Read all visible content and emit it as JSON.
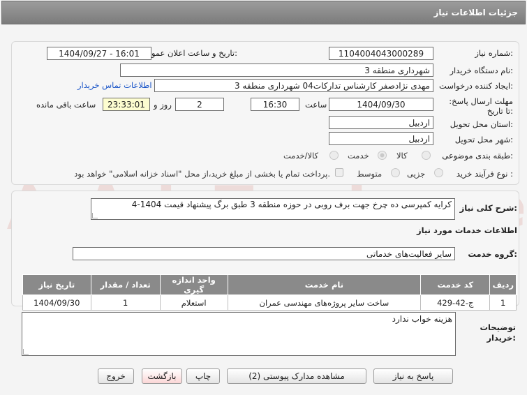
{
  "header": {
    "title": "جزئیات اطلاعات نیاز"
  },
  "form": {
    "need_number_label": "شماره نیاز:",
    "need_number": "1104004043000289",
    "announce_label": "تاریخ و ساعت اعلان عمومی:",
    "announce_value": "1404/09/27 - 16:01",
    "buyer_org_label": "نام دستگاه خریدار:",
    "buyer_org": "شهرداری منطقه 3",
    "creator_label": "ایجاد کننده درخواست:",
    "creator": "مهدی نژادصفر کارشناس تدارکات04 شهرداری منطقه 3",
    "contact_link": "اطلاعات تماس خریدار",
    "deadline_label": "مهلت ارسال پاسخ: تا تاریخ:",
    "deadline_date": "1404/09/30",
    "time_label": "ساعت",
    "deadline_time": "16:30",
    "days_value": "2",
    "days_label": "روز و",
    "remaining_time": "23:33:01",
    "remaining_label": "ساعت باقی مانده",
    "province_label": "استان محل تحویل:",
    "province": "اردبیل",
    "city_label": "شهر محل تحویل:",
    "city": "اردبیل",
    "category_label": "طبقه بندی موضوعی:",
    "category_options": [
      "کالا",
      "خدمت",
      "کالا/خدمت"
    ],
    "category_selected": "خدمت",
    "process_label": "نوع فرآیند خرید :",
    "process_options": [
      "جزیی",
      "متوسط"
    ],
    "payment_note": "پرداخت تمام یا بخشی از مبلغ خرید،از محل \"اسناد خزانه اسلامی\" خواهد بود."
  },
  "summary": {
    "label": "شرح کلی نیاز:",
    "value": "کرایه کمپرسی ده چرخ جهت برف روبی در حوزه منطقه 3 طبق برگ پیشنهاد قیمت 1404-4"
  },
  "services": {
    "section_title": "اطلاعات خدمات مورد نیاز",
    "group_label": "گروه خدمت:",
    "group_value": "سایر فعالیت‌های خدماتی",
    "columns": [
      "ردیف",
      "کد خدمت",
      "نام خدمت",
      "واحد اندازه گیری",
      "تعداد / مقدار",
      "تاریخ نیاز"
    ],
    "rows": [
      [
        "1",
        "ج-42-429",
        "ساخت سایر پروژه‌های مهندسی عمران",
        "استعلام",
        "1",
        "1404/09/30"
      ]
    ]
  },
  "buyer_notes": {
    "label": "توضیحات خریدار:",
    "value": "هزینه خواب ندارد"
  },
  "buttons": {
    "reply": "پاسخ به نیاز",
    "attachments": "مشاهده مدارک پیوستی (2)",
    "print": "چاپ",
    "back": "بازگشت",
    "exit": "خروج"
  },
  "watermark": {
    "text": "AriaTender.net"
  },
  "colors": {
    "header": "#8a8a8a",
    "link": "#1a55c8",
    "highlight": "#fdfdd0",
    "back_button": "#fde0e0",
    "watermark": "#c0392b"
  }
}
